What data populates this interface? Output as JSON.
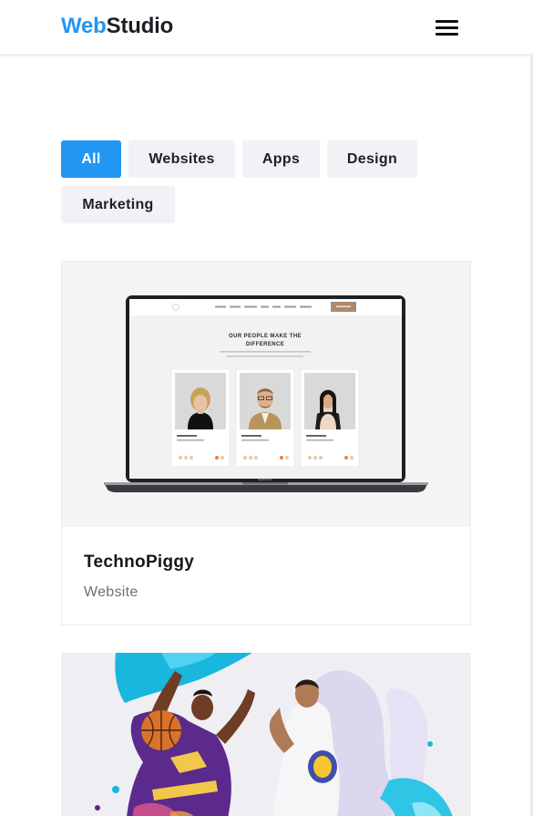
{
  "header": {
    "logo_part1": "Web",
    "logo_part2": "Studio"
  },
  "filters": [
    {
      "label": "All",
      "active": true
    },
    {
      "label": "Websites",
      "active": false
    },
    {
      "label": "Apps",
      "active": false
    },
    {
      "label": "Design",
      "active": false
    },
    {
      "label": "Marketing",
      "active": false
    }
  ],
  "projects": [
    {
      "title": "TechnoPiggy",
      "category": "Website",
      "mockup": {
        "headline_line1": "OUR PEOPLE MAKE THE",
        "headline_line2": "DIFFERENCE",
        "device_label": "MacBook Pro"
      }
    },
    {
      "title": "",
      "category": ""
    }
  ],
  "colors": {
    "accent": "#2196f3",
    "chip_bg": "#f1f1f6",
    "text_dark": "#1e1e24",
    "text_muted": "#6f6f74"
  },
  "icons": {
    "menu": "hamburger-menu-icon"
  }
}
